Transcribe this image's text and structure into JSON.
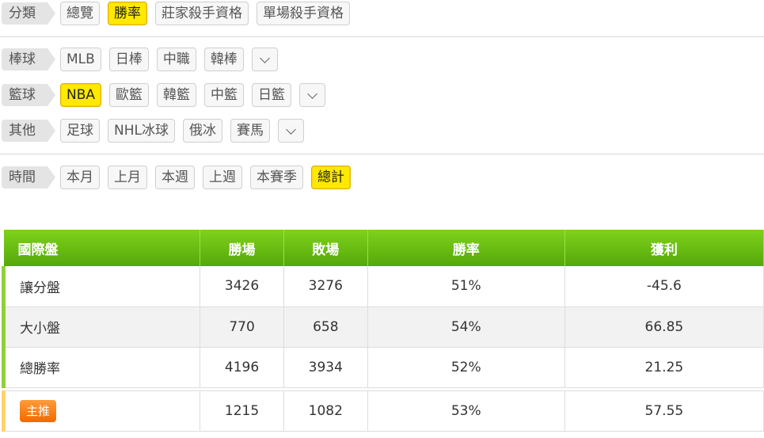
{
  "rows": {
    "category": {
      "label": "分類",
      "chips": [
        "總覽",
        "勝率",
        "莊家殺手資格",
        "單場殺手資格"
      ],
      "active": 1
    },
    "baseball": {
      "label": "棒球",
      "chips": [
        "MLB",
        "日棒",
        "中職",
        "韓棒"
      ]
    },
    "basketball": {
      "label": "籃球",
      "chips": [
        "NBA",
        "歐籃",
        "韓籃",
        "中籃",
        "日籃"
      ],
      "active": 0
    },
    "other": {
      "label": "其他",
      "chips": [
        "足球",
        "NHL冰球",
        "俄冰",
        "賽馬"
      ]
    },
    "time": {
      "label": "時間",
      "chips": [
        "本月",
        "上月",
        "本週",
        "上週",
        "本賽季",
        "總計"
      ],
      "active": 5
    }
  },
  "table": {
    "headers": [
      "國際盤",
      "勝場",
      "敗場",
      "勝率",
      "獲利"
    ],
    "rows": [
      [
        "讓分盤",
        "3426",
        "3276",
        "51%",
        "-45.6"
      ],
      [
        "大小盤",
        "770",
        "658",
        "54%",
        "66.85"
      ],
      [
        "總勝率",
        "4196",
        "3934",
        "52%",
        "21.25"
      ]
    ],
    "pick": {
      "badge": "主推",
      "values": [
        "1215",
        "1082",
        "53%",
        "57.55"
      ]
    }
  },
  "colors": {
    "accent_yellow": "#ffe900",
    "header_green": "#6cc012",
    "pick_orange": "#f47f14"
  }
}
